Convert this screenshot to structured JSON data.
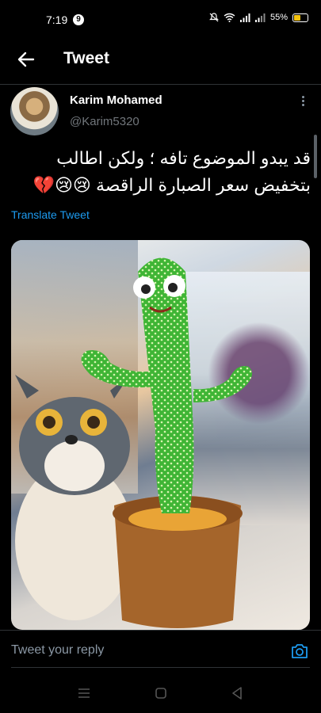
{
  "status": {
    "time": "7:19",
    "notification_count": "9",
    "battery": "55%",
    "battery_level": 0.55,
    "accent": "#f4c20d"
  },
  "header": {
    "title": "Tweet",
    "back_icon": "arrow-left-icon"
  },
  "tweet": {
    "author_name": "Karim Mohamed",
    "author_handle": "@Karim5320",
    "text_line1": "قد يبدو الموضوع تافه ؛ ولكن اطالب",
    "text_line2": "بتخفيض سعر الصبارة الراقصة 😢😢💔",
    "translate_label": "Translate Tweet",
    "media_alt": "dancing cactus toy next to plush dog",
    "link_color": "#1d9bf0"
  },
  "reply": {
    "placeholder": "Tweet your reply",
    "camera_icon": "camera-icon"
  },
  "nav": {
    "menu_icon": "menu-icon",
    "home_icon": "square-home-icon",
    "back_icon": "triangle-back-icon"
  }
}
